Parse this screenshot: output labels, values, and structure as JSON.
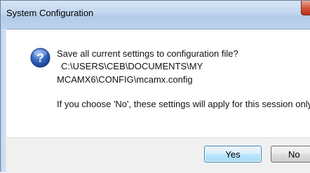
{
  "window": {
    "title": "System Configuration"
  },
  "dialog": {
    "icon": "question-icon",
    "question": "Save all current settings to configuration file?",
    "path_line1": "C:\\USERS\\CEB\\DOCUMENTS\\MY",
    "path_line2": "MCAMX6\\CONFIG\\mcamx.config",
    "note": "If you choose 'No', these settings will apply for this session only."
  },
  "buttons": {
    "yes_label": "Yes",
    "no_label": "No"
  },
  "colors": {
    "titlebar": "#c2d6ee",
    "icon_blue": "#2f62b8",
    "default_button_border": "#3c7fb1"
  }
}
